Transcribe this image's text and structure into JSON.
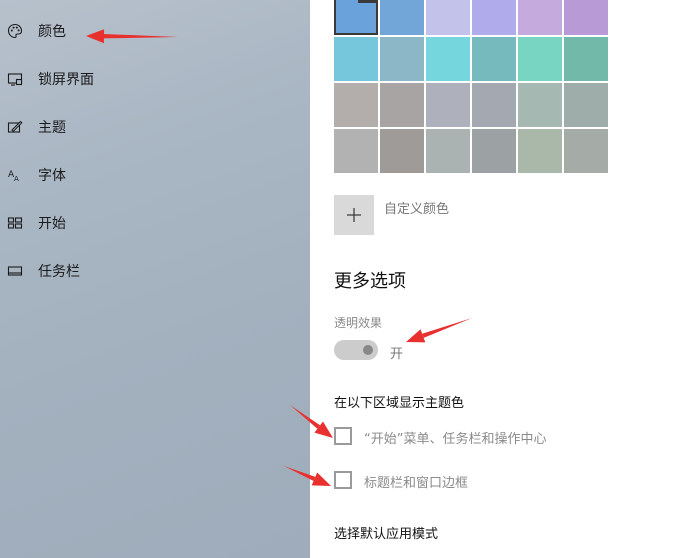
{
  "nav": {
    "items": [
      {
        "label": "颜色",
        "icon": "palette-icon"
      },
      {
        "label": "锁屏界面",
        "icon": "lock-screen-icon"
      },
      {
        "label": "主题",
        "icon": "theme-icon"
      },
      {
        "label": "字体",
        "icon": "font-icon"
      },
      {
        "label": "开始",
        "icon": "start-icon"
      },
      {
        "label": "任务栏",
        "icon": "taskbar-icon"
      }
    ]
  },
  "colors": {
    "rows": [
      [
        "#6aa3dc",
        "#73a6d8",
        "#c2c2ea",
        "#b0abea",
        "#c4aadd",
        "#b79ad6"
      ],
      [
        "#76c7dc",
        "#8bb7c6",
        "#75d6de",
        "#76babd",
        "#77d5c2",
        "#72b9aa"
      ],
      [
        "#b3adac",
        "#a7a4a3",
        "#aeb1bc",
        "#a4a8b1",
        "#a5b8b2",
        "#9fadaa"
      ],
      [
        "#b2b2b2",
        "#9f9b98",
        "#aab2b2",
        "#9ca2a4",
        "#aab8a9",
        "#a5aba6"
      ]
    ],
    "selected_index": 0,
    "custom_label": "自定义颜色"
  },
  "more_options": {
    "title": "更多选项",
    "transparency_label": "透明效果",
    "transparency_state": "开",
    "transparency_on": true
  },
  "accent": {
    "heading": "在以下区域显示主题色",
    "start_taskbar_label": "“开始”菜单、任务栏和操作中心",
    "titlebar_label": "标题栏和窗口边框"
  },
  "app_mode": {
    "heading": "选择默认应用模式"
  },
  "annotation_color": "#e8312f"
}
